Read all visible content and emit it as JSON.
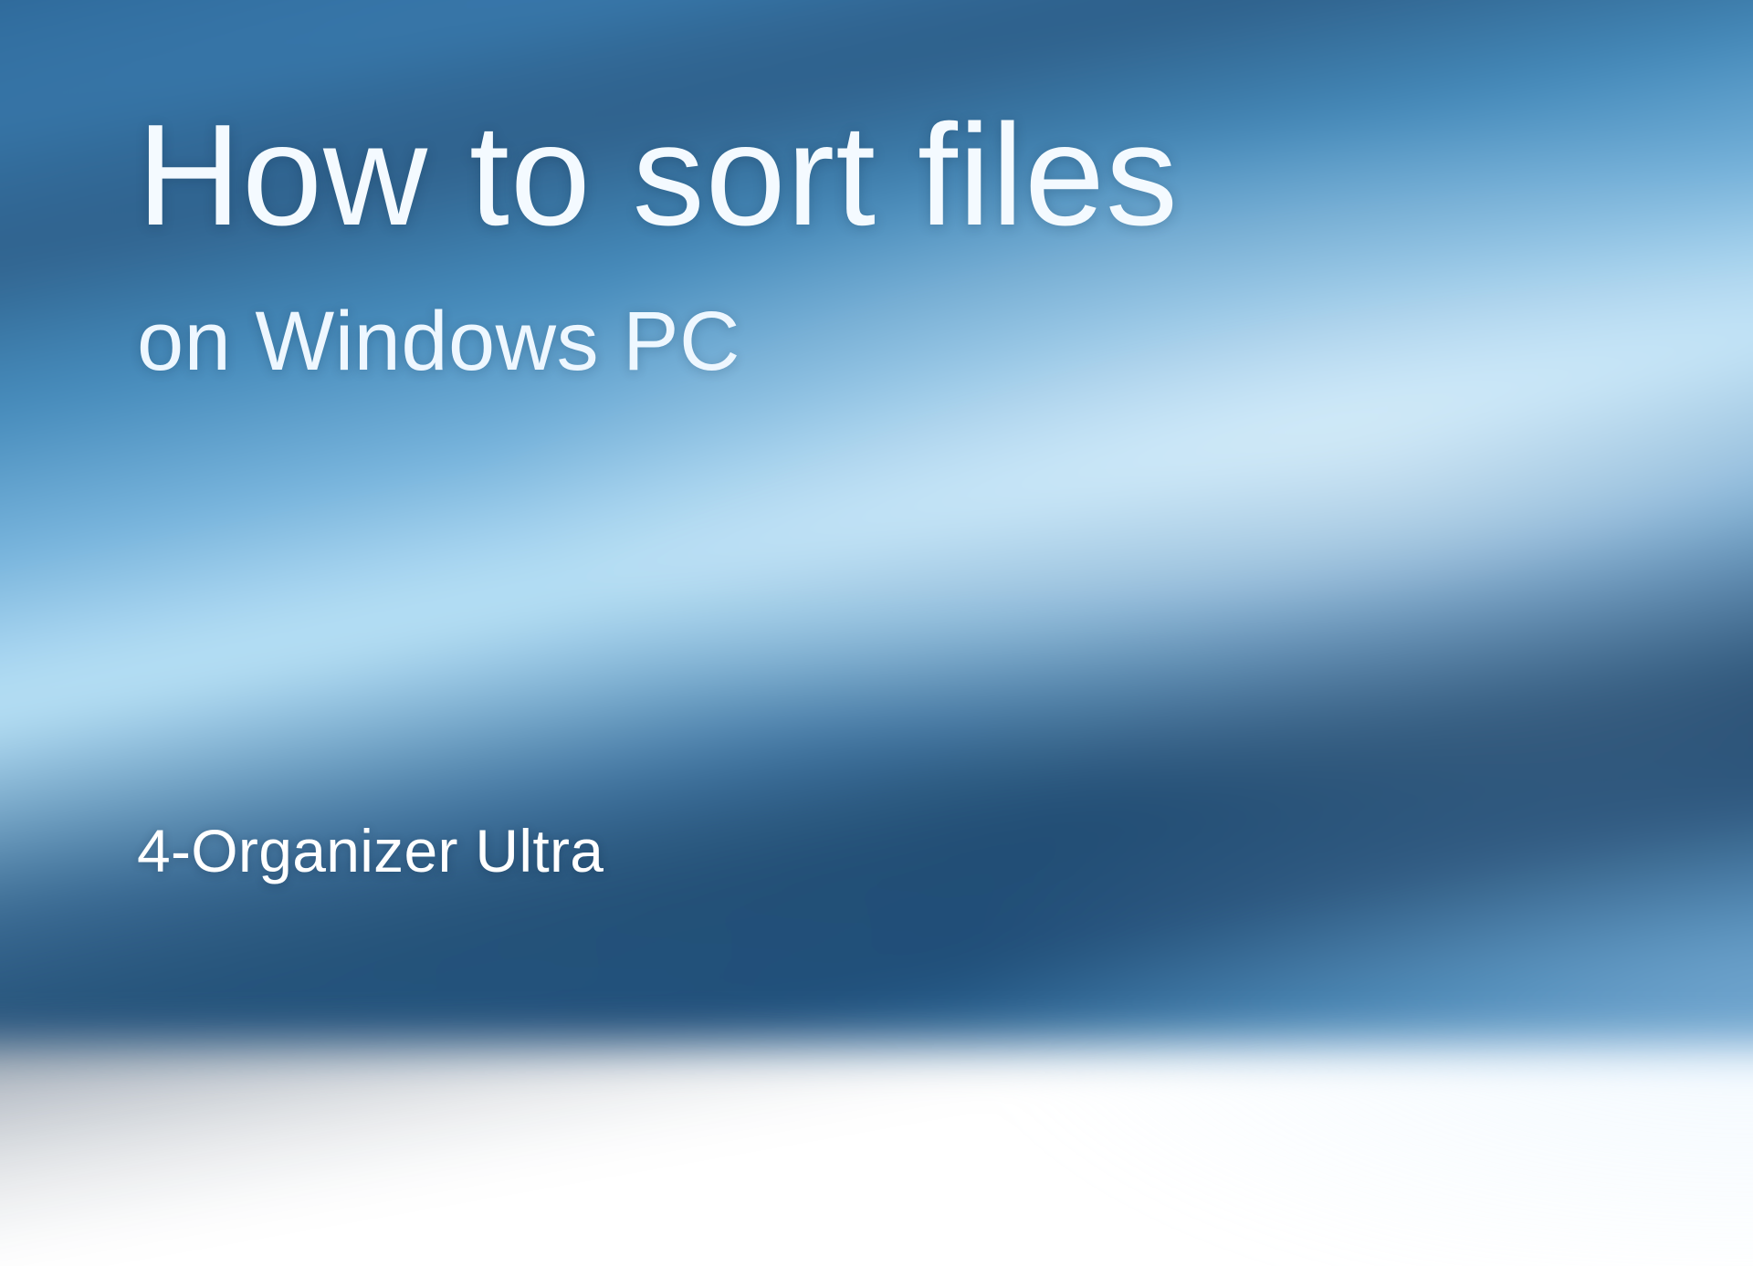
{
  "slide": {
    "title": "How to sort files",
    "subtitle": "on Windows PC",
    "product_name": "4-Organizer Ultra"
  }
}
